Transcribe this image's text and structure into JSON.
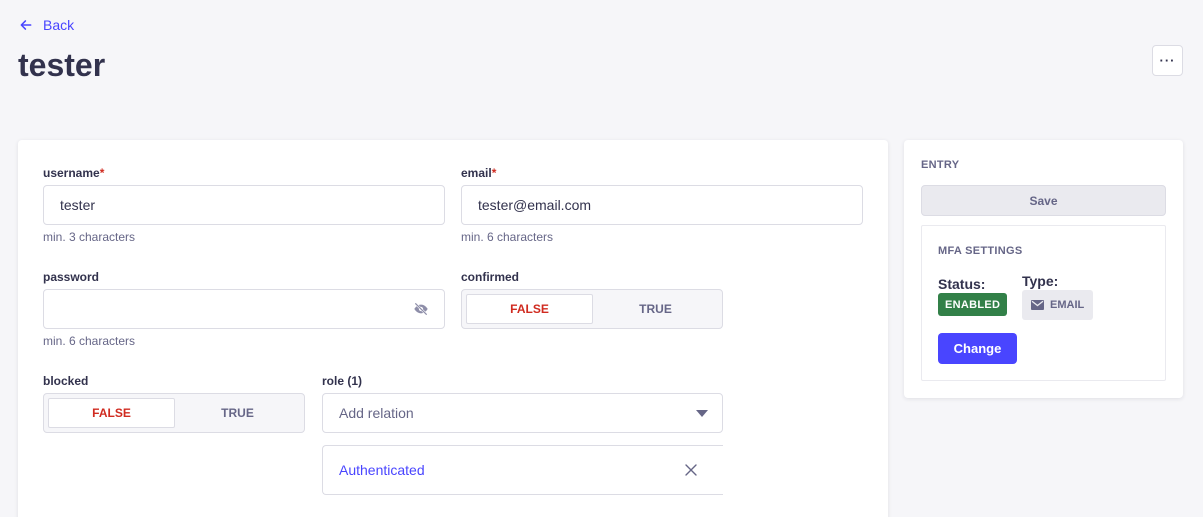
{
  "header": {
    "back_label": "Back",
    "title": "tester",
    "more_label": "···"
  },
  "form": {
    "username": {
      "label": "username",
      "required_mark": "*",
      "value": "tester",
      "hint": "min. 3 characters"
    },
    "email": {
      "label": "email",
      "required_mark": "*",
      "value": "tester@email.com",
      "hint": "min. 6 characters"
    },
    "password": {
      "label": "password",
      "value": "",
      "hint": "min. 6 characters",
      "icon": "eye-slash-icon"
    },
    "confirmed": {
      "label": "confirmed",
      "false_label": "FALSE",
      "true_label": "TRUE",
      "selected": "false"
    },
    "blocked": {
      "label": "blocked",
      "false_label": "FALSE",
      "true_label": "TRUE",
      "selected": "false"
    },
    "role": {
      "label": "role (1)",
      "placeholder": "Add relation",
      "items": [
        {
          "label": "Authenticated"
        }
      ]
    }
  },
  "sidebar": {
    "entry_heading": "ENTRY",
    "save_label": "Save",
    "mfa": {
      "heading": "MFA SETTINGS",
      "status_label": "Status:",
      "status_value": "ENABLED",
      "type_label": "Type:",
      "type_value": "EMAIL",
      "change_label": "Change"
    }
  },
  "colors": {
    "primary": "#4945ff",
    "danger": "#d02b20",
    "success": "#328048",
    "text": "#32324d",
    "muted": "#666687",
    "background": "#f6f6f9"
  }
}
